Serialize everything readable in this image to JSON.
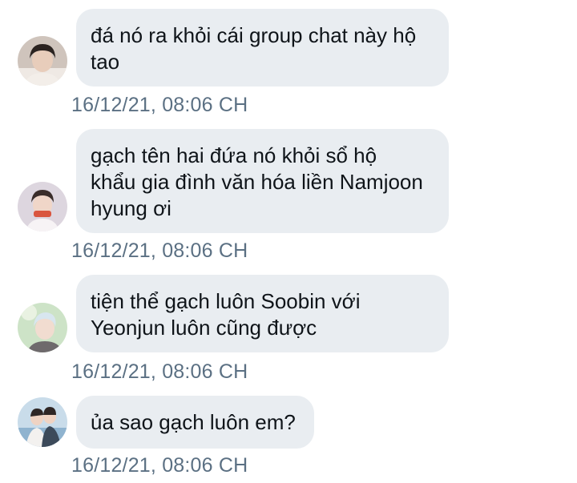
{
  "messages": [
    {
      "text": "đá nó ra khỏi cái group chat này hộ\ntao",
      "timestamp": "16/12/21, 08:06 CH",
      "avatar_icon": "user-avatar-1"
    },
    {
      "text": "gạch tên hai đứa nó khỏi sổ hộ\nkhẩu gia đình văn hóa liền Namjoon\nhyung ơi",
      "timestamp": "16/12/21, 08:06 CH",
      "avatar_icon": "user-avatar-2"
    },
    {
      "text": "tiện thể gạch luôn Soobin với\nYeonjun luôn cũng được",
      "timestamp": "16/12/21, 08:06 CH",
      "avatar_icon": "user-avatar-3"
    },
    {
      "text": "ủa sao gạch luôn em?",
      "timestamp": "16/12/21, 08:06 CH",
      "avatar_icon": "user-avatar-4"
    }
  ],
  "colors": {
    "bubble_bg": "#e9edf1",
    "text": "#0f1419",
    "timestamp": "#5b7083"
  }
}
